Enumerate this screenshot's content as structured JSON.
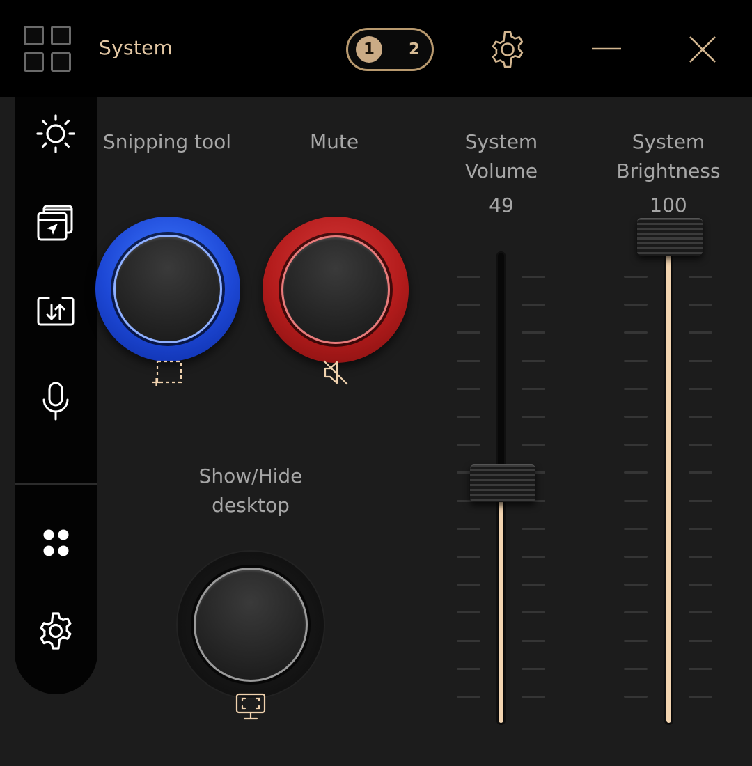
{
  "window": {
    "title": "System",
    "pages": [
      "1",
      "2"
    ],
    "active_page": "1"
  },
  "controls": {
    "snipping_label": "Snipping tool",
    "mute_label": "Mute",
    "desktop_label": "Show/Hide desktop"
  },
  "sliders": {
    "volume": {
      "label": "System Volume",
      "value": "49"
    },
    "brightness": {
      "label": "System Brightness",
      "value": "100"
    }
  },
  "colors": {
    "accent": "#cbab85",
    "snipping_ring": "#1d48d6",
    "mute_ring": "#b41c1c",
    "slider_fill": "#f2d4b0"
  },
  "sidebar": {
    "items": [
      "sun-icon",
      "window-cursor-icon",
      "screen-transfer-icon",
      "microphone-icon",
      "apps-dots-icon",
      "gear-icon"
    ]
  }
}
